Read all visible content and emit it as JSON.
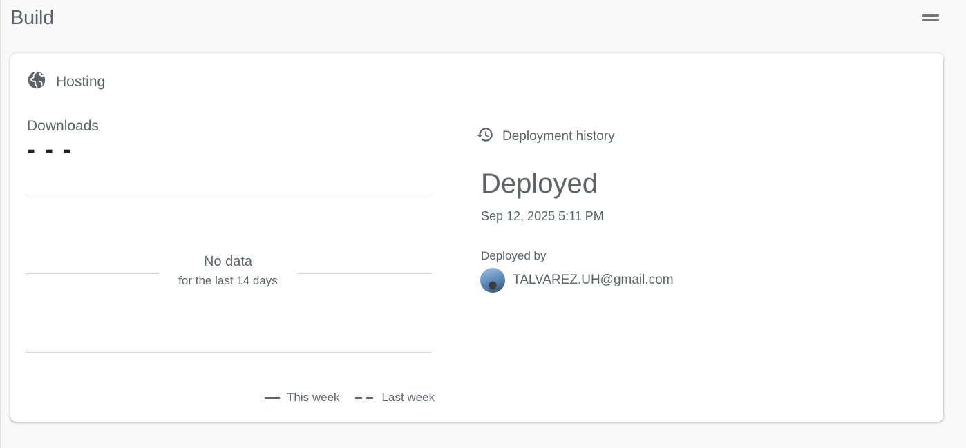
{
  "section": {
    "title": "Build"
  },
  "hosting": {
    "title": "Hosting",
    "icon": "globe-icon",
    "downloads": {
      "label": "Downloads",
      "value": "- - -"
    },
    "chart": {
      "empty_title": "No data",
      "empty_subtitle": "for the last 14 days",
      "legend": {
        "this_week": "This week",
        "last_week": "Last week"
      }
    },
    "deployment": {
      "header": "Deployment history",
      "icon": "history-icon",
      "status": "Deployed",
      "timestamp": "Sep 12, 2025 5:11 PM",
      "deployed_by_label": "Deployed by",
      "deployed_by_email": "TALVAREZ.UH@gmail.com"
    }
  },
  "colors": {
    "text": "#5f6368",
    "value": "#202124",
    "card_bg": "#ffffff",
    "page_bg": "#f8f8f8"
  }
}
